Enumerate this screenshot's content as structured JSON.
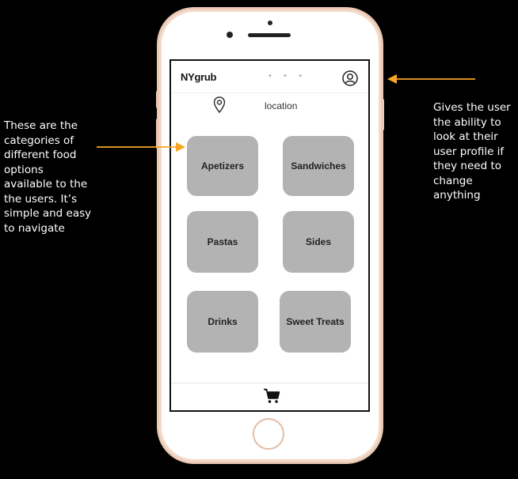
{
  "app": {
    "logo": "NYgrub",
    "header_dots": "• • •",
    "location_label": "location"
  },
  "categories": [
    {
      "label": "Apetizers"
    },
    {
      "label": "Sandwiches"
    },
    {
      "label": "Pastas"
    },
    {
      "label": "Sides"
    },
    {
      "label": "Drinks"
    },
    {
      "label": "Sweet Treats"
    }
  ],
  "icons": {
    "profile": "user-profile-icon",
    "location": "location-pin-icon",
    "cart": "shopping-cart-icon"
  },
  "annotations": {
    "left": "These are the categories of different food options available to the the users. It’s simple and easy to navigate",
    "right": "Gives the user the ability to look at their user profile if they need to change anything"
  },
  "colors": {
    "background": "#000000",
    "category_button": "#b3b3b3",
    "arrow": "#f5a623",
    "phone_frame": "#ecc9b3"
  }
}
